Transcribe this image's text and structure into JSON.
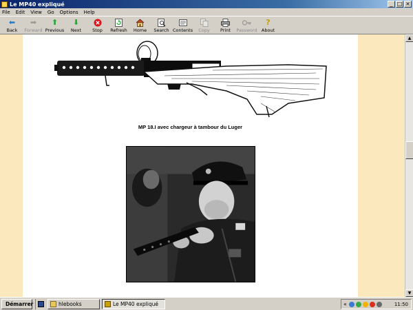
{
  "window": {
    "title": "Le MP40 expliqué"
  },
  "menu": {
    "items": [
      "File",
      "Edit",
      "View",
      "Go",
      "Options",
      "Help"
    ]
  },
  "toolbar": {
    "buttons": [
      {
        "label": "Back",
        "icon": "back-arrow-icon",
        "enabled": true
      },
      {
        "label": "Forward",
        "icon": "forward-arrow-icon",
        "enabled": false
      },
      {
        "label": "Previous",
        "icon": "up-arrow-icon",
        "enabled": true
      },
      {
        "label": "Next",
        "icon": "down-arrow-icon",
        "enabled": true
      },
      {
        "label": "Stop",
        "icon": "stop-icon",
        "enabled": true
      },
      {
        "label": "Refresh",
        "icon": "refresh-icon",
        "enabled": true
      },
      {
        "label": "Home",
        "icon": "home-icon",
        "enabled": true
      },
      {
        "label": "Search",
        "icon": "search-icon",
        "enabled": true
      },
      {
        "label": "Contents",
        "icon": "contents-icon",
        "enabled": true
      },
      {
        "label": "Copy",
        "icon": "copy-icon",
        "enabled": false
      },
      {
        "label": "Print",
        "icon": "print-icon",
        "enabled": true
      },
      {
        "label": "Password",
        "icon": "key-icon",
        "enabled": false
      },
      {
        "label": "About",
        "icon": "help-icon",
        "enabled": true
      }
    ]
  },
  "content": {
    "caption": "MP 18.I avec chargeur à tambour du Luger",
    "background": "#fbe9bd",
    "page_background": "#ffffff"
  },
  "taskbar": {
    "start_label": "Démarrer",
    "tasks": [
      {
        "label": "hlebooks",
        "active": false
      },
      {
        "label": "Le MP40 expliqué",
        "active": true
      }
    ],
    "tray_prefix": "«",
    "clock": "11:50"
  },
  "colors": {
    "titlebar_start": "#0a246a",
    "chrome": "#d4d0c8"
  }
}
